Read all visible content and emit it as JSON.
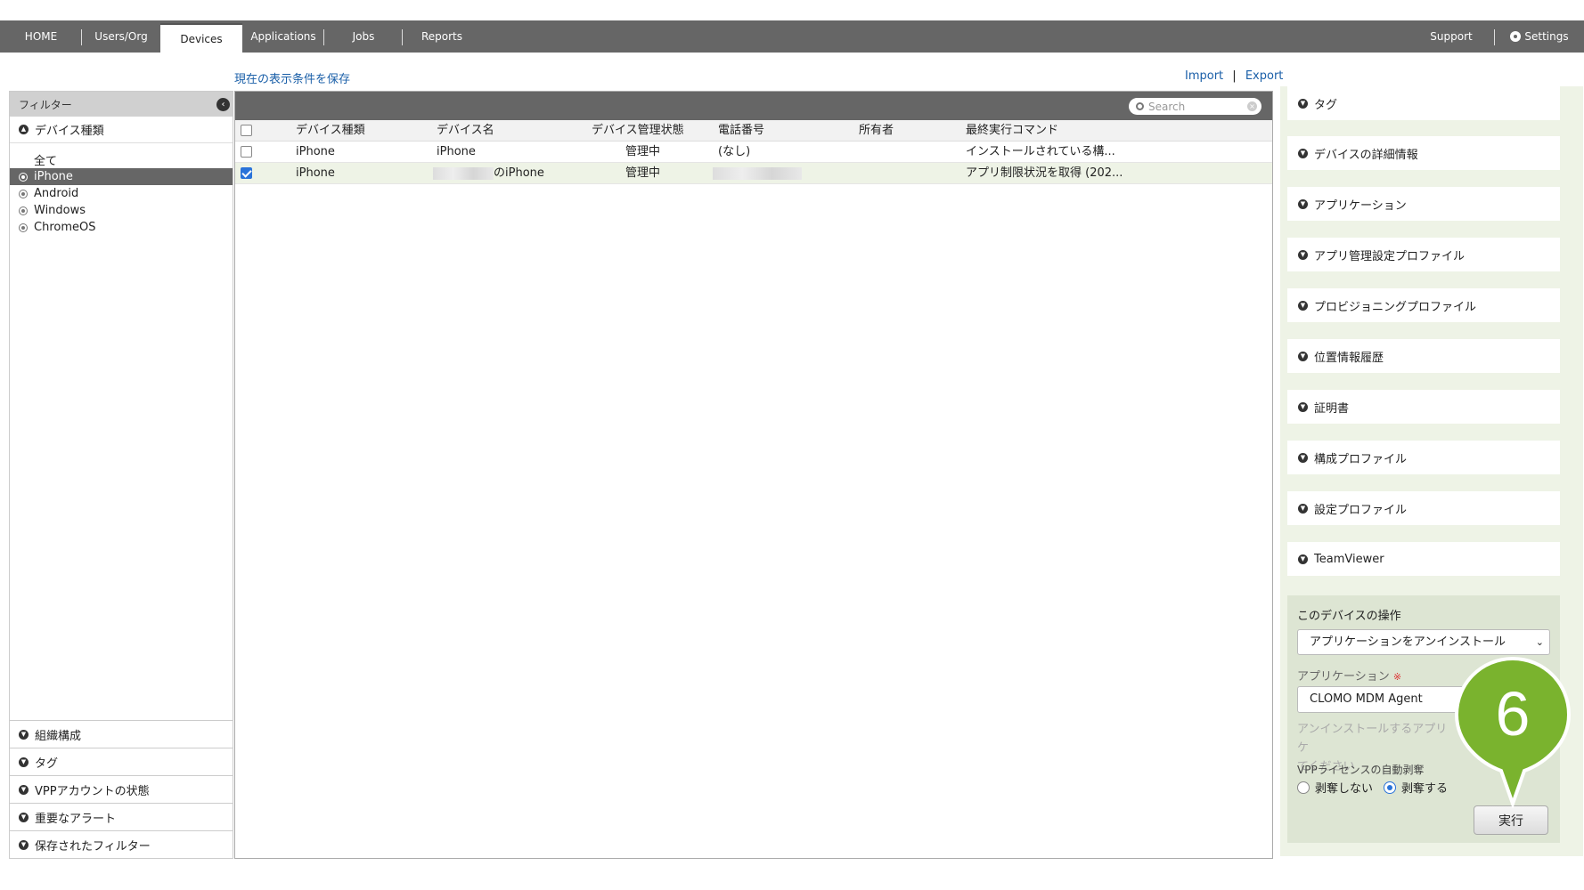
{
  "nav": {
    "tabs": [
      "HOME",
      "Users/Org",
      "Devices",
      "Applications",
      "Jobs",
      "Reports"
    ],
    "support": "Support",
    "settings": "Settings"
  },
  "header": {
    "save_view": "現在の表示条件を保存",
    "import": "Import",
    "sep": "|",
    "export": "Export"
  },
  "filter": {
    "title": "フィルター",
    "device_type_section": "デバイス種類",
    "items": [
      "全て",
      "iPhone",
      "Android",
      "Windows",
      "ChromeOS"
    ],
    "bottom_sections": [
      "組織構成",
      "タグ",
      "VPPアカウントの状態",
      "重要なアラート",
      "保存されたフィルター"
    ]
  },
  "search": {
    "placeholder": "Search"
  },
  "table": {
    "columns": [
      "デバイス種類",
      "デバイス名",
      "デバイス管理状態",
      "電話番号",
      "所有者",
      "最終実行コマンド"
    ],
    "rows": [
      {
        "type": "iPhone",
        "name": "iPhone",
        "status": "管理中",
        "phone": "(なし)",
        "owner": "",
        "command": "インストールされている構..."
      },
      {
        "type": "iPhone",
        "name": "のiPhone",
        "status": "管理中",
        "phone": "",
        "owner": "",
        "command": "アプリ制限状況を取得 (202..."
      }
    ]
  },
  "details": {
    "sections": [
      "タグ",
      "デバイスの詳細情報",
      "アプリケーション",
      "アプリ管理設定プロファイル",
      "プロビジョニングプロファイル",
      "位置情報履歴",
      "証明書",
      "構成プロファイル",
      "設定プロファイル",
      "TeamViewer"
    ]
  },
  "operation": {
    "title": "このデバイスの操作",
    "selected_action": "アプリケーションをアンインストール",
    "app_label": "アプリケーション",
    "required_mark": "※",
    "app_value": "CLOMO MDM Agent",
    "help_line1": "アンインストールするアプリケ",
    "help_line2": "てください",
    "vpp_label": "VPPライセンスの自動剥奪",
    "radio_no": "剥奪しない",
    "radio_yes": "剥奪する",
    "run_button": "実行"
  },
  "callout": {
    "number": "6",
    "color": "#7ab32e"
  }
}
